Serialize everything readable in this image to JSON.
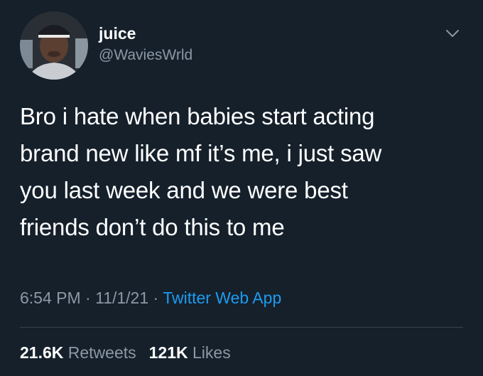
{
  "user": {
    "display_name": "juice",
    "handle": "@WaviesWrld"
  },
  "tweet": {
    "text": "Bro i hate when babies start acting\nbrand new like mf it’s me, i just saw\nyou last week and we were best\nfriends don’t do this to me",
    "time": "6:54 PM",
    "separator": "·",
    "date": "11/1/21",
    "source": "Twitter Web App"
  },
  "stats": {
    "retweets_count": "21.6K",
    "retweets_label": "Retweets",
    "likes_count": "121K",
    "likes_label": "Likes"
  },
  "colors": {
    "background": "#15202b",
    "text_primary": "#ffffff",
    "text_secondary": "#8b98a5",
    "accent": "#1d9bf0",
    "divider": "#38444d"
  },
  "icons": {
    "menu": "chevron-down-icon"
  }
}
